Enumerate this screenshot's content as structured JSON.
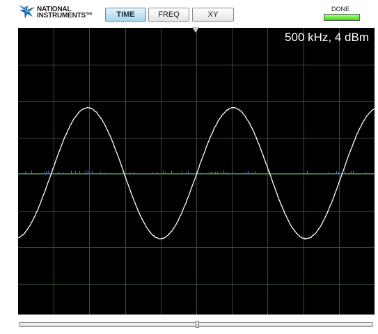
{
  "brand": {
    "logo_icon": "ni-eagle-icon",
    "line1": "NATIONAL",
    "line2": "INSTRUMENTS™"
  },
  "mode_buttons": [
    {
      "label": "TIME",
      "active": true
    },
    {
      "label": "FREQ",
      "active": false
    },
    {
      "label": "XY",
      "active": false
    }
  ],
  "status": {
    "label": "DONE",
    "led_color": "#33dd00"
  },
  "readout": "500 kHz, 4 dBm",
  "scope": {
    "background": "#000000",
    "grid_color": "#3c4f3c",
    "trace_color": "#ffffff",
    "reference_color": "#4f6fd8",
    "trigger_marker_icon": "trigger-down-triangle-icon",
    "level_marker_icon": "level-right-triangle-icon",
    "cycles_shown": 2.45
  },
  "scroll": {
    "position": 0.5
  }
}
